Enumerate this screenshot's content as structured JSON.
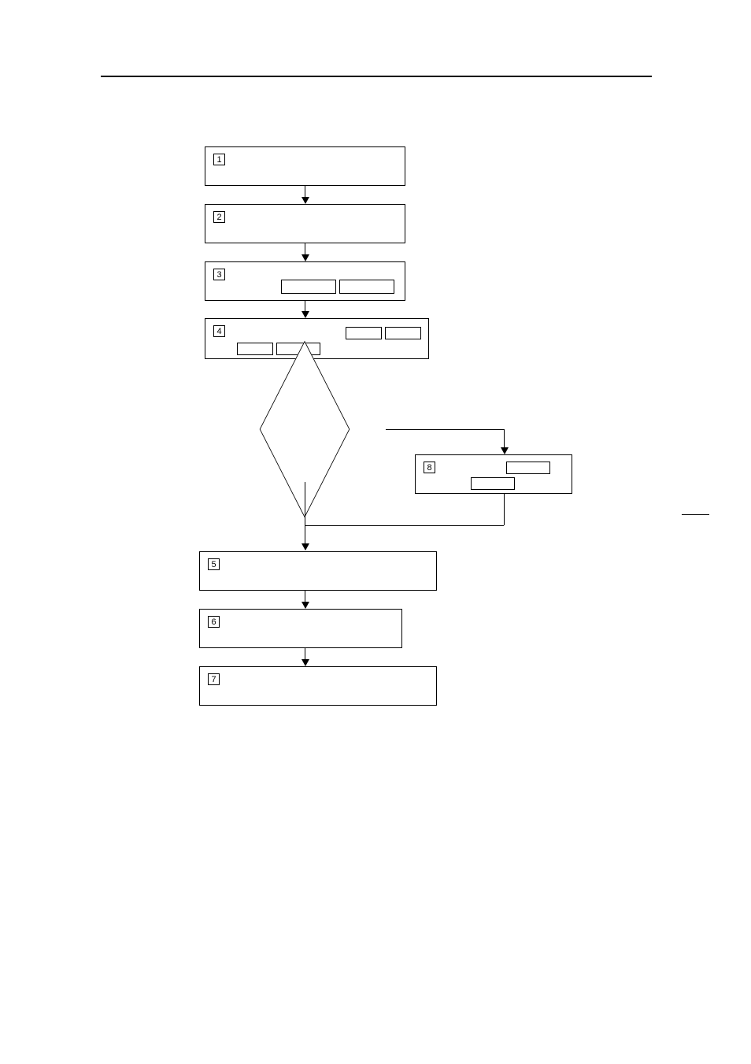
{
  "steps": {
    "1": "1",
    "2": "2",
    "3": "3",
    "4": "4",
    "5": "5",
    "6": "6",
    "7": "7",
    "8": "8"
  }
}
